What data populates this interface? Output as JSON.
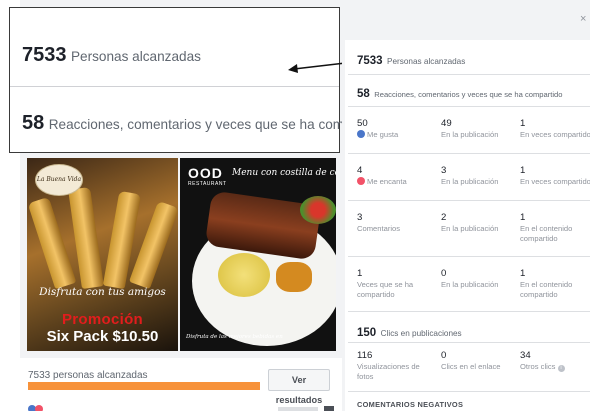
{
  "zoom": {
    "reach_number": "7533",
    "reach_label": "Personas alcanzadas",
    "engagement_number": "58",
    "engagement_label": "Reacciones, comentarios y veces que se ha compartido"
  },
  "post": {
    "left_image": {
      "badge": "La Buena Vida",
      "caption": "Disfruta con tus amigos",
      "promo": "Promoción",
      "price": "Six Pack $10.50"
    },
    "right_image": {
      "logo": "OOD",
      "logo_sub": "RESTAURANT",
      "title": "Menu con costilla de cerdo",
      "caption": "Disfruta de las mejores bebidas en"
    },
    "reach_text": "7533 personas alcanzadas",
    "reach_progress_percent": 100,
    "results_button": "Ver resultados"
  },
  "panel": {
    "close": "×",
    "reach_number": "7533",
    "reach_label": "Personas alcanzadas",
    "engagement_number": "58",
    "engagement_label": "Reacciones, comentarios y veces que se ha compartido",
    "rows": [
      {
        "c1_num": "50",
        "c1_label": "Me gusta",
        "c2_num": "49",
        "c2_label": "En la publicación",
        "c3_num": "1",
        "c3_label": "En veces compartido"
      },
      {
        "c1_num": "4",
        "c1_label": "Me encanta",
        "c2_num": "3",
        "c2_label": "En la publicación",
        "c3_num": "1",
        "c3_label": "En veces compartido"
      },
      {
        "c1_num": "3",
        "c1_label": "Comentarios",
        "c2_num": "2",
        "c2_label": "En la publicación",
        "c3_num": "1",
        "c3_label": "En el contenido compartido"
      },
      {
        "c1_num": "1",
        "c1_label": "Veces que se ha compartido",
        "c2_num": "0",
        "c2_label": "En la publicación",
        "c3_num": "1",
        "c3_label": "En el contenido compartido"
      }
    ],
    "clicks_number": "150",
    "clicks_label": "Clics en publicaciones",
    "click_stats": [
      {
        "num": "116",
        "label": "Visualizaciones de fotos"
      },
      {
        "num": "0",
        "label": "Clics en el enlace"
      },
      {
        "num": "34",
        "label": "Otros clics"
      }
    ],
    "negative_title": "COMENTARIOS NEGATIVOS"
  },
  "icons": {
    "like": "thumbs-up-icon",
    "love": "heart-icon",
    "info": "info-icon"
  }
}
